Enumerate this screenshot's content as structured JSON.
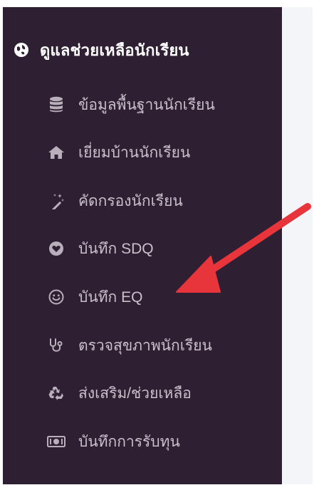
{
  "sidebar": {
    "section": {
      "label": "ดูแลช่วยเหลือนักเรียน",
      "icon": "globe-icon"
    },
    "items": [
      {
        "label": "ข้อมูลพื้นฐานนักเรียน",
        "icon": "database-icon"
      },
      {
        "label": "เยี่ยมบ้านนักเรียน",
        "icon": "home-icon"
      },
      {
        "label": "คัดกรองนักเรียน",
        "icon": "magic-wand-icon"
      },
      {
        "label": "บันทึก SDQ",
        "icon": "heart-icon"
      },
      {
        "label": "บันทึก EQ",
        "icon": "smile-icon"
      },
      {
        "label": "ตรวจสุขภาพนักเรียน",
        "icon": "stethoscope-icon"
      },
      {
        "label": "ส่งเสริม/ช่วยเหลือ",
        "icon": "recycle-icon"
      },
      {
        "label": "บันทึกการรับทุน",
        "icon": "money-bill-icon"
      }
    ]
  },
  "annotation": {
    "arrow_color": "#e8353b",
    "points_to": "บันทึก EQ"
  },
  "colors": {
    "sidebar_bg": "#2f1f33",
    "item_text": "#c9c0cb",
    "header_text": "#ffffff",
    "content_bg": "#f4f5f8"
  }
}
